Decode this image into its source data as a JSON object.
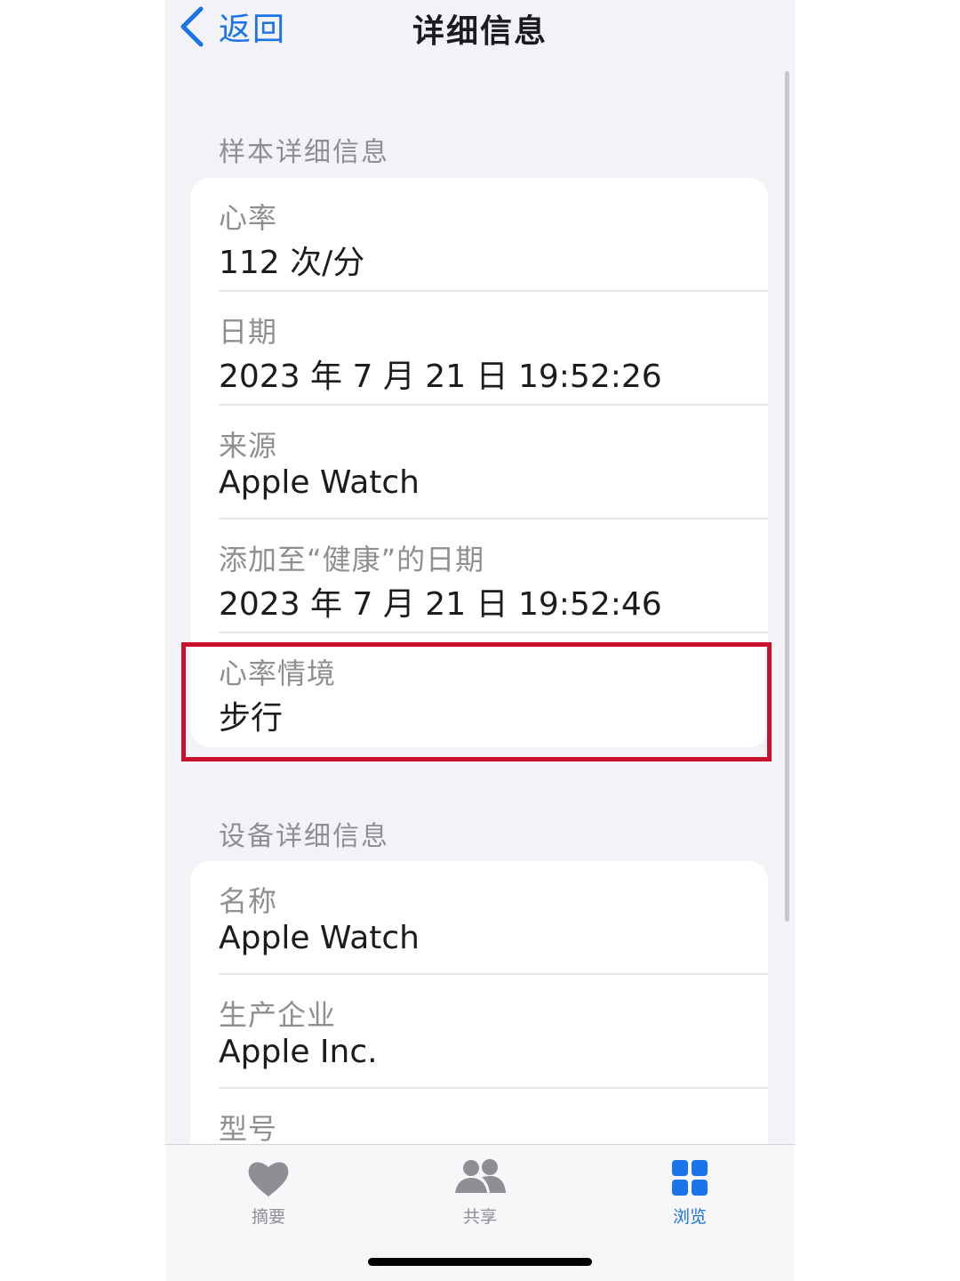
{
  "nav": {
    "back_label": "返回",
    "title": "详细信息"
  },
  "sample_section": {
    "header": "样本详细信息",
    "rows": [
      {
        "label": "心率",
        "value": "112 次/分"
      },
      {
        "label": "日期",
        "value": "2023 年 7 月 21 日 19:52:26"
      },
      {
        "label": "来源",
        "value": "Apple Watch"
      },
      {
        "label": "添加至“健康”的日期",
        "value": "2023 年 7 月 21 日 19:52:46"
      },
      {
        "label": "心率情境",
        "value": "步行"
      }
    ]
  },
  "device_section": {
    "header": "设备详细信息",
    "rows": [
      {
        "label": "名称",
        "value": "Apple Watch"
      },
      {
        "label": "生产企业",
        "value": "Apple Inc."
      },
      {
        "label": "型号",
        "value": ""
      }
    ]
  },
  "tabs": [
    {
      "label": "摘要",
      "icon": "heart-icon"
    },
    {
      "label": "共享",
      "icon": "people-icon"
    },
    {
      "label": "浏览",
      "icon": "grid-icon",
      "active": true
    }
  ],
  "colors": {
    "accent": "#1a73e8",
    "highlight": "#c8102e",
    "background": "#f2f2f7"
  }
}
